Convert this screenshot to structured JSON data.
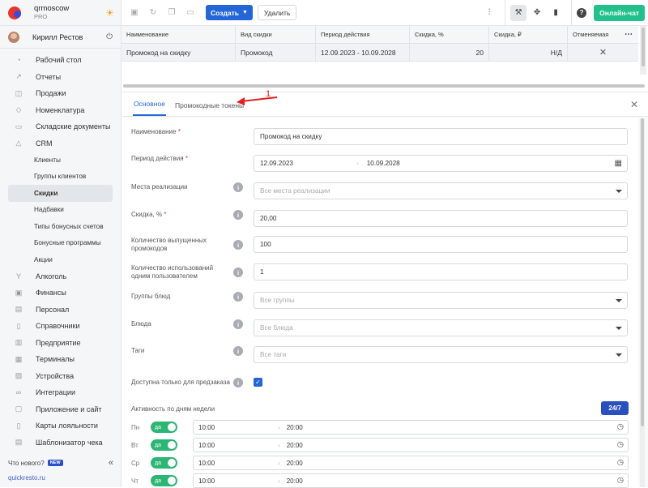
{
  "brand": {
    "name": "qrmoscow",
    "plan": "PRO"
  },
  "user": {
    "name": "Кирилл Рестов"
  },
  "nav": {
    "items": [
      {
        "label": "Рабочий стол",
        "icon": "speedometer-icon",
        "glyph": "◔"
      },
      {
        "label": "Отчеты",
        "icon": "chart-icon",
        "glyph": "↗"
      },
      {
        "label": "Продажи",
        "icon": "bag-icon",
        "glyph": "◫"
      },
      {
        "label": "Номенклатура",
        "icon": "tag-icon",
        "glyph": "◇"
      },
      {
        "label": "Складские документы",
        "icon": "box-icon",
        "glyph": "▭"
      },
      {
        "label": "CRM",
        "icon": "crm-icon",
        "glyph": "△"
      }
    ],
    "crm_sub": [
      {
        "label": "Клиенты"
      },
      {
        "label": "Группы клиентов"
      },
      {
        "label": "Скидки",
        "active": true
      },
      {
        "label": "Надбавки"
      },
      {
        "label": "Типы бонусных счетов"
      },
      {
        "label": "Бонусные программы"
      },
      {
        "label": "Акции"
      }
    ],
    "items2": [
      {
        "label": "Алкоголь",
        "icon": "glass-icon",
        "glyph": "Y"
      },
      {
        "label": "Финансы",
        "icon": "wallet-icon",
        "glyph": "▣"
      },
      {
        "label": "Персонал",
        "icon": "people-icon",
        "glyph": "▤"
      },
      {
        "label": "Справочники",
        "icon": "book-icon",
        "glyph": "▯"
      },
      {
        "label": "Предприятие",
        "icon": "building-icon",
        "glyph": "▥"
      },
      {
        "label": "Терминалы",
        "icon": "terminal-icon",
        "glyph": "▦"
      },
      {
        "label": "Устройства",
        "icon": "printer-icon",
        "glyph": "▨"
      },
      {
        "label": "Интеграции",
        "icon": "link-icon",
        "glyph": "∞"
      },
      {
        "label": "Приложение и сайт",
        "icon": "app-icon",
        "glyph": "▢"
      },
      {
        "label": "Карты лояльности",
        "icon": "card-icon",
        "glyph": "▯"
      },
      {
        "label": "Шаблонизатор чека",
        "icon": "receipt-icon",
        "glyph": "▤"
      }
    ]
  },
  "whats_new": {
    "label": "Что нового?",
    "badge": "NEW"
  },
  "footer_link": "quickresto.ru",
  "toolbar": {
    "create_label": "Создать",
    "delete_label": "Удалить",
    "chat_label": "Онлайн-чат"
  },
  "grid": {
    "columns": [
      "Наименование",
      "Вид скидки",
      "Период действия",
      "Скидка, %",
      "Скидка, ₽",
      "Отменяемая"
    ],
    "row": {
      "name": "Промокод на скидку",
      "kind": "Промокод",
      "period": "12.09.2023 - 10.09.2028",
      "percent": "20",
      "rub": "Н/Д"
    }
  },
  "tabs": [
    {
      "label": "Основное",
      "active": true
    },
    {
      "label": "Промокодные токены"
    }
  ],
  "annotation": {
    "number": "1",
    "color": "#e02020"
  },
  "form": {
    "name": {
      "label": "Наименование",
      "value": "Промокод на скидку"
    },
    "period": {
      "label": "Период действия",
      "from": "12.09.2023",
      "to": "10.09.2028"
    },
    "places": {
      "label": "Места реализации",
      "placeholder": "Все места реализации"
    },
    "discount": {
      "label": "Скидка, %",
      "value": "20,00"
    },
    "issued": {
      "label": "Количество выпущенных промокодов",
      "value": "100"
    },
    "uses": {
      "label": "Количество использований одним пользователем",
      "value": "1"
    },
    "dish_groups": {
      "label": "Группы блюд",
      "placeholder": "Все группы"
    },
    "dishes": {
      "label": "Блюда",
      "placeholder": "Все блюда"
    },
    "tags": {
      "label": "Таги",
      "placeholder": "Все таги"
    },
    "preorder": {
      "label": "Доступна только для предзаказа",
      "checked": true
    },
    "week": {
      "label": "Активность по дням недели",
      "badge": "24/7"
    },
    "days": [
      {
        "day": "Пн",
        "toggle": "да",
        "from": "10:00",
        "to": "20:00"
      },
      {
        "day": "Вт",
        "toggle": "да",
        "from": "10:00",
        "to": "20:00"
      },
      {
        "day": "Ср",
        "toggle": "да",
        "from": "10:00",
        "to": "20:00"
      },
      {
        "day": "Чт",
        "toggle": "да",
        "from": "10:00",
        "to": "20:00"
      }
    ]
  },
  "colors": {
    "accent": "#2466d6",
    "success": "#22c08a",
    "annotation": "#e02020"
  }
}
